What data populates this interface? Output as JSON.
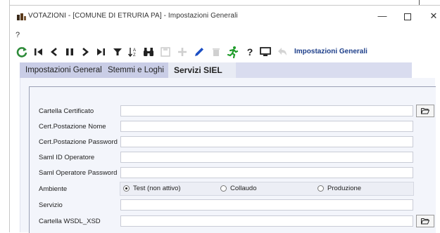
{
  "window": {
    "title": "VOTAZIONI - [COMUNE DI ETRURIA PA] - Impostazioni Generali",
    "minimize_glyph": "—",
    "close_glyph": "✕"
  },
  "menubar": {
    "help": "?"
  },
  "toolbar": {
    "section_label": "Impostazioni Generali",
    "help_glyph": "?",
    "icons": [
      "refresh-icon",
      "first-record-icon",
      "prev-record-icon",
      "pause-icon",
      "next-record-icon",
      "last-record-icon",
      "filter-icon",
      "sort-icon",
      "binoculars-icon",
      "save-icon",
      "add-icon",
      "edit-icon",
      "delete-icon",
      "exit-icon",
      "help-icon",
      "monitor-icon",
      "back-icon"
    ],
    "colors": {
      "refresh": "#2e8b3a",
      "exit": "#1f9c2a",
      "edit": "#1c4fc4",
      "label": "#1e3f8a"
    }
  },
  "tabs": [
    {
      "label": "Impostazioni Generali",
      "active": false
    },
    {
      "label": "Stemmi e Loghi",
      "active": false
    },
    {
      "label": "Servizi SIEL",
      "active": true
    }
  ],
  "form": {
    "cartella_certificato": {
      "label": "Cartella Certificato",
      "value": ""
    },
    "cert_postazione_nome": {
      "label": "Cert.Postazione Nome",
      "value": ""
    },
    "cert_postazione_password": {
      "label": "Cert.Postazione Password",
      "value": ""
    },
    "saml_id_operatore": {
      "label": "Saml ID Operatore",
      "value": ""
    },
    "saml_operatore_password": {
      "label": "Saml Operatore Password",
      "value": ""
    },
    "ambiente": {
      "label": "Ambiente",
      "options": [
        "Test (non attivo)",
        "Collaudo",
        "Produzione"
      ],
      "selected": "Test (non attivo)"
    },
    "servizio": {
      "label": "Servizio",
      "value": ""
    },
    "cartella_wsdl_xsd": {
      "label": "Cartella WSDL_XSD",
      "value": ""
    }
  }
}
